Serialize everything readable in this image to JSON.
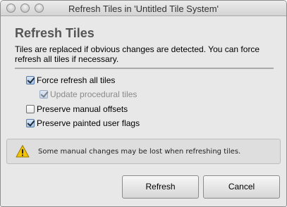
{
  "window": {
    "title": "Refresh Tiles in 'Untitled Tile System'"
  },
  "heading": "Refresh Tiles",
  "description": "Tiles are replaced if obvious changes are detected. You can force refresh all tiles if necessary.",
  "options": [
    {
      "label": "Force refresh all tiles",
      "checked": true,
      "enabled": true
    },
    {
      "label": "Update procedural tiles",
      "checked": true,
      "enabled": false
    },
    {
      "label": "Preserve manual offsets",
      "checked": false,
      "enabled": true
    },
    {
      "label": "Preserve painted user flags",
      "checked": true,
      "enabled": true
    }
  ],
  "warning": {
    "icon": "warning-triangle-icon",
    "text": "Some manual changes may be lost when refreshing tiles."
  },
  "buttons": {
    "refresh_label": "Refresh",
    "cancel_label": "Cancel"
  },
  "colors": {
    "warning_yellow": "#f2c400",
    "heading_gray": "#555555"
  }
}
